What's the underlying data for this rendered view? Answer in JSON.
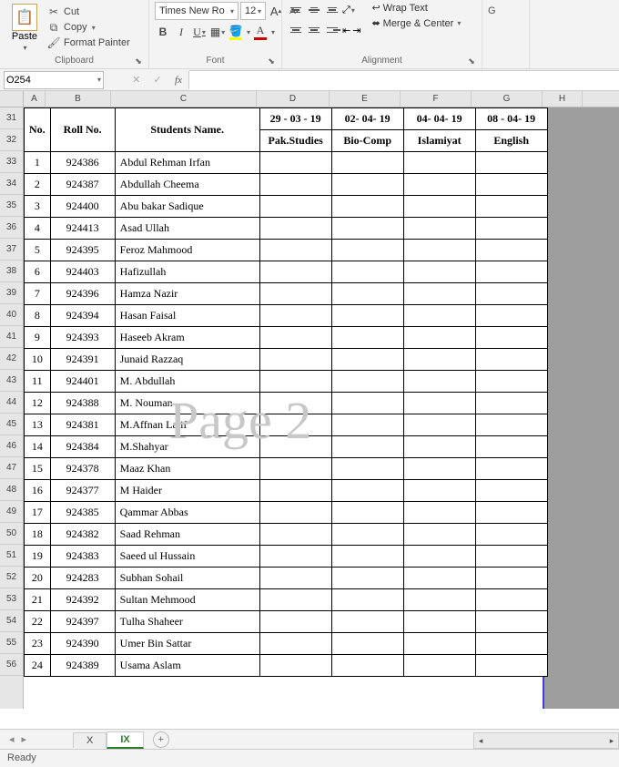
{
  "ribbon": {
    "clipboard": {
      "label": "Clipboard",
      "paste": "Paste",
      "cut": "Cut",
      "copy": "Copy",
      "format_painter": "Format Painter"
    },
    "font": {
      "label": "Font",
      "name": "Times New Ro",
      "size": "12",
      "bold": "B",
      "italic": "I",
      "underline": "U"
    },
    "alignment": {
      "label": "Alignment",
      "wrap": "Wrap Text",
      "merge": "Merge & Center"
    },
    "number": {
      "label": ""
    }
  },
  "namebox": "O254",
  "fx": "fx",
  "cols": {
    "A": "A",
    "B": "B",
    "C": "C",
    "D": "D",
    "E": "E",
    "F": "F",
    "G": "G",
    "H": "H"
  },
  "row_labels": [
    "31",
    "32",
    "33",
    "34",
    "35",
    "36",
    "37",
    "38",
    "39",
    "40",
    "41",
    "42",
    "43",
    "44",
    "45",
    "46",
    "47",
    "48",
    "49",
    "50",
    "51",
    "52",
    "53",
    "54",
    "55",
    "56"
  ],
  "header": {
    "no": "No.",
    "roll": "Roll No.",
    "name": "Students Name.",
    "dates": [
      "29 - 03 - 19",
      "02- 04- 19",
      "04- 04- 19",
      "08 - 04- 19"
    ],
    "subjects": [
      "Pak.Studies",
      "Bio-Comp",
      "Islamiyat",
      "English"
    ]
  },
  "rows": [
    {
      "n": "1",
      "r": "924386",
      "s": "Abdul Rehman Irfan"
    },
    {
      "n": "2",
      "r": "924387",
      "s": "Abdullah Cheema"
    },
    {
      "n": "3",
      "r": "924400",
      "s": "Abu bakar Sadique"
    },
    {
      "n": "4",
      "r": "924413",
      "s": "Asad Ullah"
    },
    {
      "n": "5",
      "r": "924395",
      "s": "Feroz Mahmood"
    },
    {
      "n": "6",
      "r": "924403",
      "s": "Hafizullah"
    },
    {
      "n": "7",
      "r": "924396",
      "s": "Hamza Nazir"
    },
    {
      "n": "8",
      "r": "924394",
      "s": "Hasan Faisal"
    },
    {
      "n": "9",
      "r": "924393",
      "s": "Haseeb Akram"
    },
    {
      "n": "10",
      "r": "924391",
      "s": "Junaid Razzaq"
    },
    {
      "n": "11",
      "r": "924401",
      "s": "M. Abdullah"
    },
    {
      "n": "12",
      "r": "924388",
      "s": "M. Nouman"
    },
    {
      "n": "13",
      "r": "924381",
      "s": "M.Affnan Latif"
    },
    {
      "n": "14",
      "r": "924384",
      "s": "M.Shahyar"
    },
    {
      "n": "15",
      "r": "924378",
      "s": "Maaz Khan"
    },
    {
      "n": "16",
      "r": "924377",
      "s": "M Haider"
    },
    {
      "n": "17",
      "r": "924385",
      "s": "Qammar Abbas"
    },
    {
      "n": "18",
      "r": "924382",
      "s": "Saad Rehman"
    },
    {
      "n": "19",
      "r": "924383",
      "s": "Saeed ul Hussain"
    },
    {
      "n": "20",
      "r": "924283",
      "s": "Subhan Sohail"
    },
    {
      "n": "21",
      "r": "924392",
      "s": "Sultan Mehmood"
    },
    {
      "n": "22",
      "r": "924397",
      "s": "Tulha Shaheer"
    },
    {
      "n": "23",
      "r": "924390",
      "s": "Umer Bin Sattar"
    },
    {
      "n": "24",
      "r": "924389",
      "s": "Usama Aslam"
    }
  ],
  "watermark": "Page 2",
  "tabs": {
    "t1": "X",
    "t2": "IX"
  },
  "status": "Ready"
}
